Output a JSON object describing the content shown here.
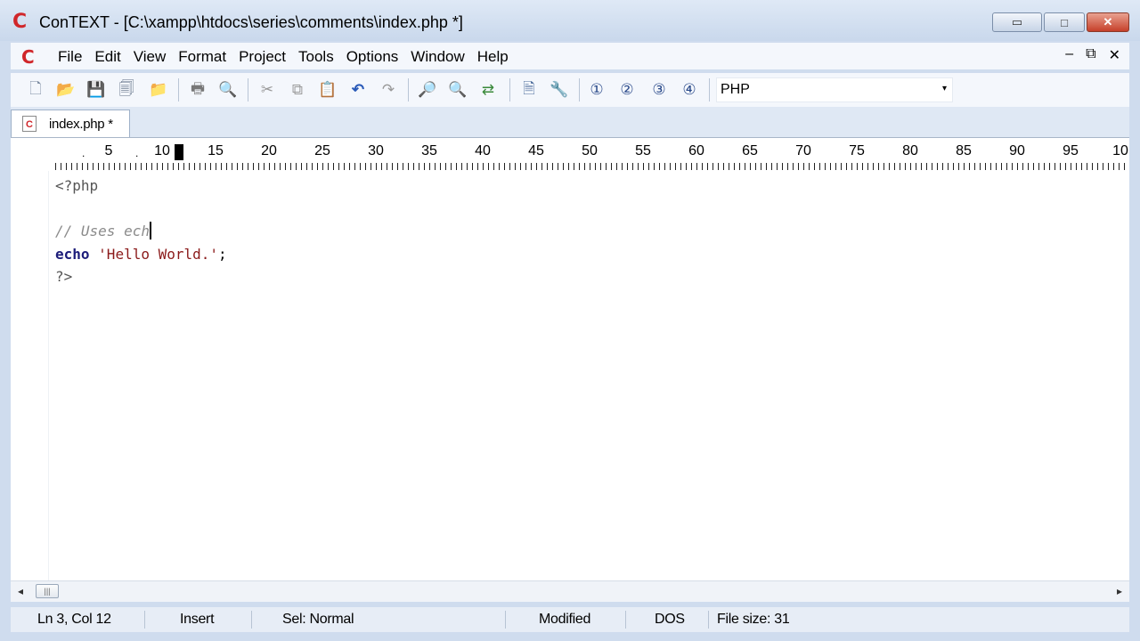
{
  "window": {
    "title": "ConTEXT - [C:\\xampp\\htdocs\\series\\comments\\index.php *]",
    "app_logo": "C",
    "controls": {
      "minimize": "▭",
      "maximize": "□",
      "close": "✕"
    }
  },
  "menu": {
    "logo": "C",
    "items": [
      "File",
      "Edit",
      "View",
      "Format",
      "Project",
      "Tools",
      "Options",
      "Window",
      "Help"
    ],
    "mdi_controls": {
      "minimize": "–",
      "restore": "⧉",
      "close": "✕"
    }
  },
  "toolbar": {
    "language": "PHP",
    "dropdown_arrow": "▾",
    "icons": [
      {
        "name": "new-file-icon",
        "glyph": "🗋"
      },
      {
        "name": "open-file-icon",
        "glyph": "📂"
      },
      {
        "name": "save-icon",
        "glyph": "💾"
      },
      {
        "name": "save-all-icon",
        "glyph": "🗐"
      },
      {
        "name": "open-folder-icon",
        "glyph": "📁"
      },
      {
        "name": "print-icon",
        "glyph": "🖶"
      },
      {
        "name": "print-preview-icon",
        "glyph": "🔍"
      },
      {
        "name": "cut-icon",
        "glyph": "✂"
      },
      {
        "name": "copy-icon",
        "glyph": "⧉"
      },
      {
        "name": "paste-icon",
        "glyph": "📋"
      },
      {
        "name": "undo-icon",
        "glyph": "↶"
      },
      {
        "name": "redo-icon",
        "glyph": "↷"
      },
      {
        "name": "find-icon",
        "glyph": "🔎"
      },
      {
        "name": "find-next-icon",
        "glyph": "🔍"
      },
      {
        "name": "replace-icon",
        "glyph": "⇄"
      },
      {
        "name": "file-compare-icon",
        "glyph": "🗎"
      },
      {
        "name": "tools-icon",
        "glyph": "🔧"
      },
      {
        "name": "user-command-1-icon",
        "glyph": "①"
      },
      {
        "name": "user-command-2-icon",
        "glyph": "②"
      },
      {
        "name": "user-command-3-icon",
        "glyph": "③"
      },
      {
        "name": "user-command-4-icon",
        "glyph": "④"
      }
    ]
  },
  "tabs": [
    {
      "label": "index.php *",
      "icon": "C"
    }
  ],
  "ruler": {
    "numbers": [
      "5",
      "10",
      "15",
      "20",
      "25",
      "30",
      "35",
      "40",
      "45",
      "50",
      "55",
      "60",
      "65",
      "70",
      "75",
      "80",
      "85",
      "90",
      "95",
      "10"
    ]
  },
  "editor": {
    "lines": {
      "l1_tag": "<?php",
      "l3_comment": "// Uses ech",
      "l4_kw": "echo",
      "l4_str": "'Hello World.'",
      "l4_end": ";",
      "l5_tag": "?>"
    }
  },
  "scrollbar": {
    "left_arrow": "◂",
    "right_arrow": "▸",
    "thumb": "|||"
  },
  "status": {
    "position": "Ln 3, Col 12",
    "mode": "Insert",
    "selection": "Sel: Normal",
    "modified": "Modified",
    "line_endings": "DOS",
    "file_size": "File size: 31"
  }
}
